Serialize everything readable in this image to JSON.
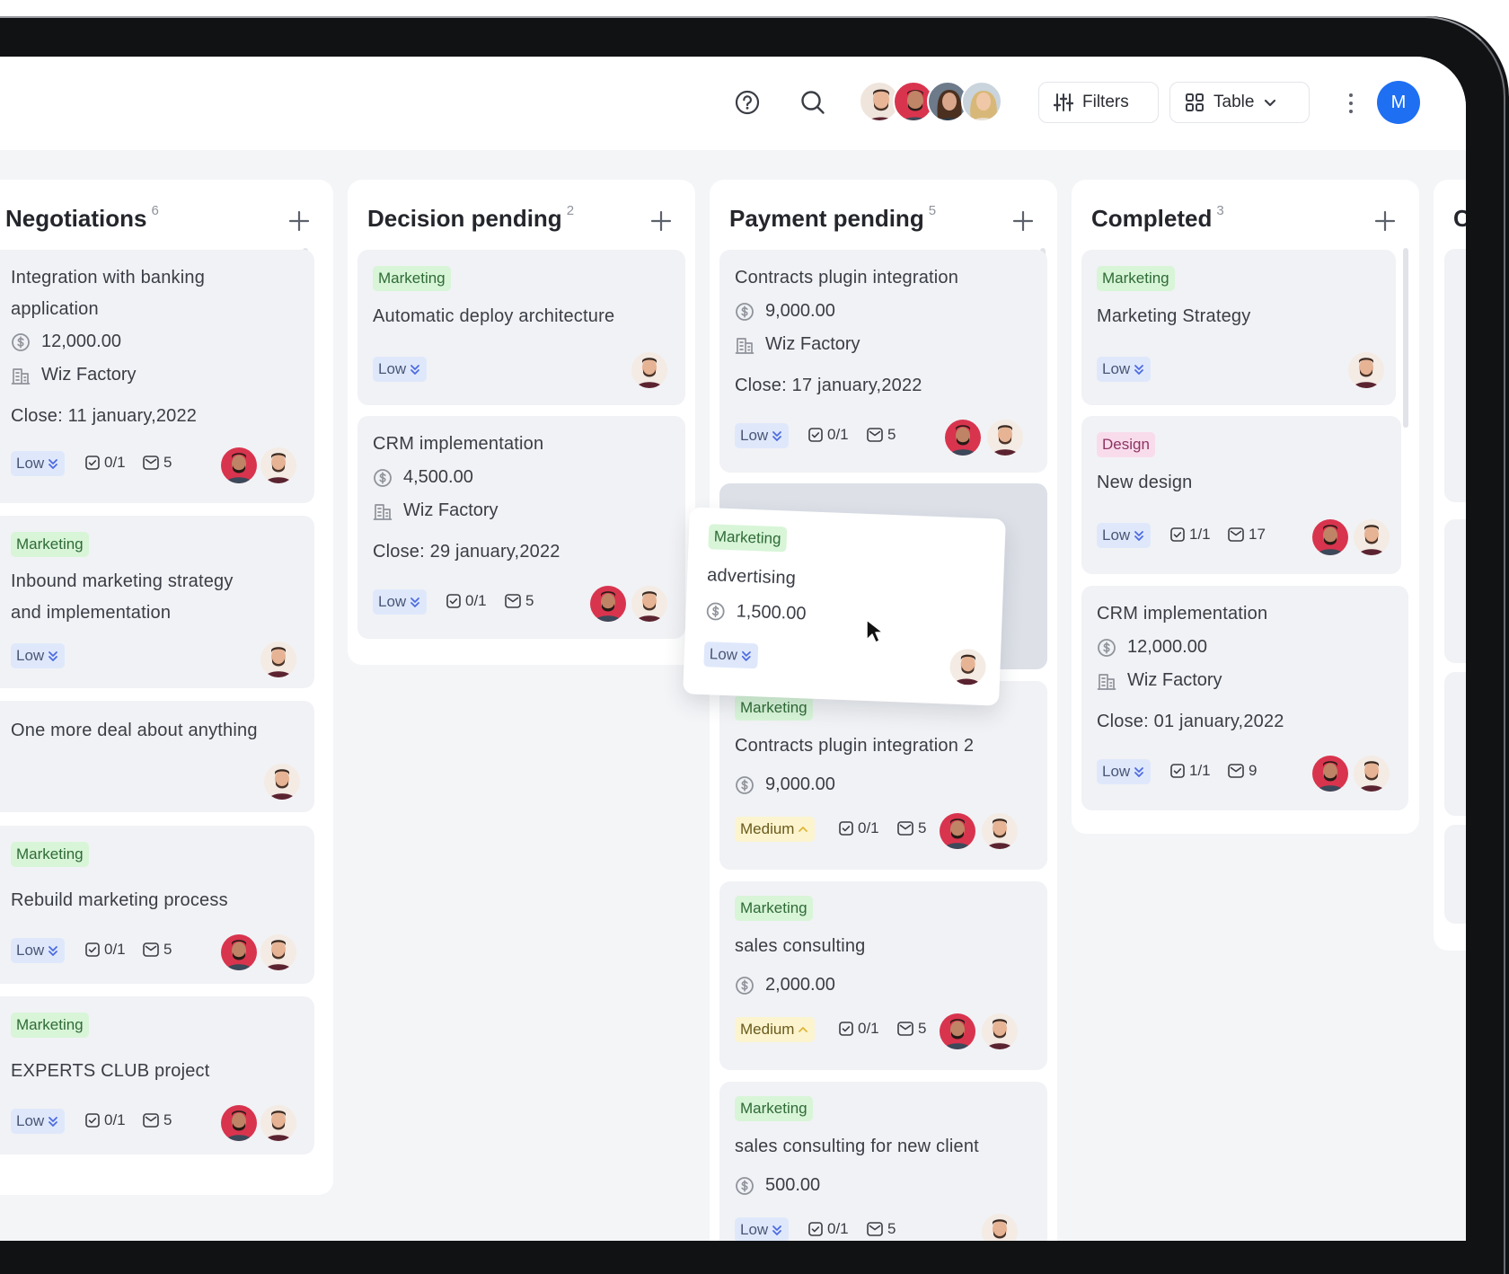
{
  "toolbar": {
    "filters_label": "Filters",
    "view_label": "Table",
    "user_initial": "M"
  },
  "colors": {
    "accent": "#1f6ff2",
    "tag_marketing_bg": "#d8f5d8",
    "tag_design_bg": "#f9dcec",
    "priority_low_bg": "#dfe8fb",
    "priority_medium_bg": "#fbf4cf"
  },
  "columns": [
    {
      "title": "Negotiations",
      "count": "6",
      "cards": [
        {
          "title_line1": "Integration with banking",
          "title_line2": "application",
          "amount": "12,000.00",
          "company": "Wiz Factory",
          "close": "Close: 11 january,2022",
          "priority": "Low",
          "tasks": "0/1",
          "comments": "5"
        },
        {
          "tag": "Marketing",
          "title_line1": "Inbound marketing strategy",
          "title_line2": "and implementation",
          "priority": "Low"
        },
        {
          "title": "One more deal about anything"
        },
        {
          "tag": "Marketing",
          "title": "Rebuild marketing process",
          "priority": "Low",
          "tasks": "0/1",
          "comments": "5"
        },
        {
          "tag": "Marketing",
          "title": "EXPERTS CLUB project",
          "priority": "Low",
          "tasks": "0/1",
          "comments": "5"
        }
      ]
    },
    {
      "title": "Decision pending",
      "count": "2",
      "cards": [
        {
          "tag": "Marketing",
          "title": "Automatic deploy architecture",
          "priority": "Low"
        },
        {
          "title": "CRM implementation",
          "amount": "4,500.00",
          "company": "Wiz Factory",
          "close": "Close: 29 january,2022",
          "priority": "Low",
          "tasks": "0/1",
          "comments": "5"
        }
      ]
    },
    {
      "title": "Payment pending",
      "count": "5",
      "cards": [
        {
          "title": "Contracts plugin integration",
          "amount": "9,000.00",
          "company": "Wiz Factory",
          "close": "Close: 17 january,2022",
          "priority": "Low",
          "tasks": "0/1",
          "comments": "5"
        },
        {
          "tag": "Marketing",
          "title": "Contracts plugin integration 2",
          "amount": "9,000.00",
          "priority": "Medium",
          "tasks": "0/1",
          "comments": "5"
        },
        {
          "tag": "Marketing",
          "title": "sales consulting",
          "amount": "2,000.00",
          "priority": "Medium",
          "tasks": "0/1",
          "comments": "5"
        },
        {
          "tag": "Marketing",
          "title": "sales consulting for new client",
          "amount": "500.00",
          "priority": "Low",
          "tasks": "0/1",
          "comments": "5"
        }
      ]
    },
    {
      "title": "Completed",
      "count": "3",
      "cards": [
        {
          "tag": "Marketing",
          "title": "Marketing Strategy",
          "priority": "Low"
        },
        {
          "tag": "Design",
          "title": "New design",
          "priority": "Low",
          "tasks": "1/1",
          "comments": "17"
        },
        {
          "title": "CRM implementation",
          "amount": "12,000.00",
          "company": "Wiz Factory",
          "close": "Close: 01 january,2022",
          "priority": "Low",
          "tasks": "1/1",
          "comments": "9"
        }
      ]
    }
  ],
  "dragged_card": {
    "tag": "Marketing",
    "title": "advertising",
    "amount": "1,500.00",
    "priority": "Low"
  },
  "partial_column": {
    "title_fragment": "C"
  }
}
